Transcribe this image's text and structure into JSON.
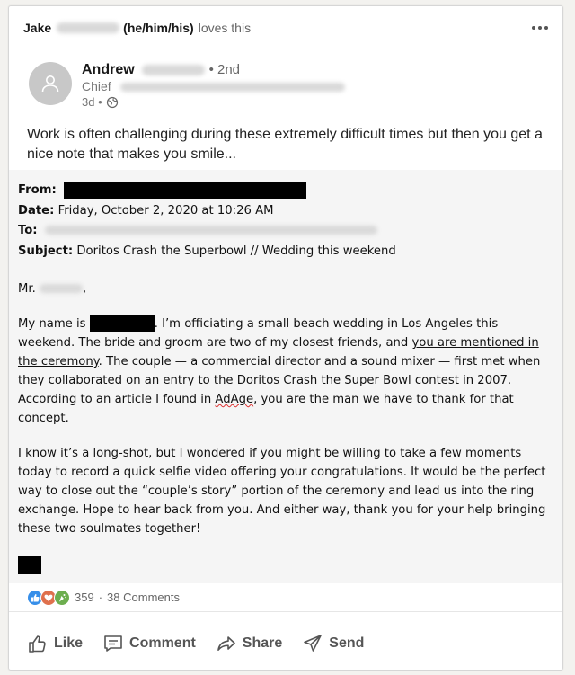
{
  "activity": {
    "actor": "Jake",
    "pronouns": "(he/him/his)",
    "action": "loves this"
  },
  "post": {
    "author_name": "Andrew",
    "degree": "• 2nd",
    "author_title": "Chief",
    "time": "3d •",
    "text": "Work is often challenging during these extremely difficult times but then you get a nice note that makes you smile..."
  },
  "email": {
    "from_label": "From:",
    "date_label": "Date:",
    "date_value": "Friday, October 2, 2020 at 10:26 AM",
    "to_label": "To:",
    "subject_label": "Subject:",
    "subject_value": "Doritos Crash the Superbowl // Wedding this weekend",
    "salutation": "Mr.",
    "salutation_end": ",",
    "p1_a": "My name is",
    "p1_b": ". I’m officiating a small beach wedding in Los Angeles this weekend. The bride and groom are two of my closest friends, and",
    "p1_link": "you are mentioned in the ceremony",
    "p1_c": ". The couple — a commercial director and a sound mixer — first met when they collaborated on an entry to the Doritos Crash the Super Bowl contest in 2007. According to an article I found in",
    "p1_adage": "AdAge",
    "p1_d": ", you are the man we have to thank for that concept.",
    "p2": "I know it’s a long-shot, but I wondered if you might be willing to take a few moments today to record a quick selfie video offering your congratulations. It would be the perfect way to close out the “couple’s story” portion of the ceremony and lead us into the ring exchange. Hope to hear back from you. And either way, thank you for your help bringing these two soulmates together!"
  },
  "social": {
    "reactions": "359",
    "separator": "·",
    "comments": "38 Comments",
    "reaction_icons": [
      "like-icon",
      "love-icon",
      "celebrate-icon"
    ]
  },
  "actions": {
    "like": "Like",
    "comment": "Comment",
    "share": "Share",
    "send": "Send"
  },
  "colors": {
    "like": "#378fe9",
    "love": "#df704d",
    "celebrate": "#6dae4f"
  }
}
